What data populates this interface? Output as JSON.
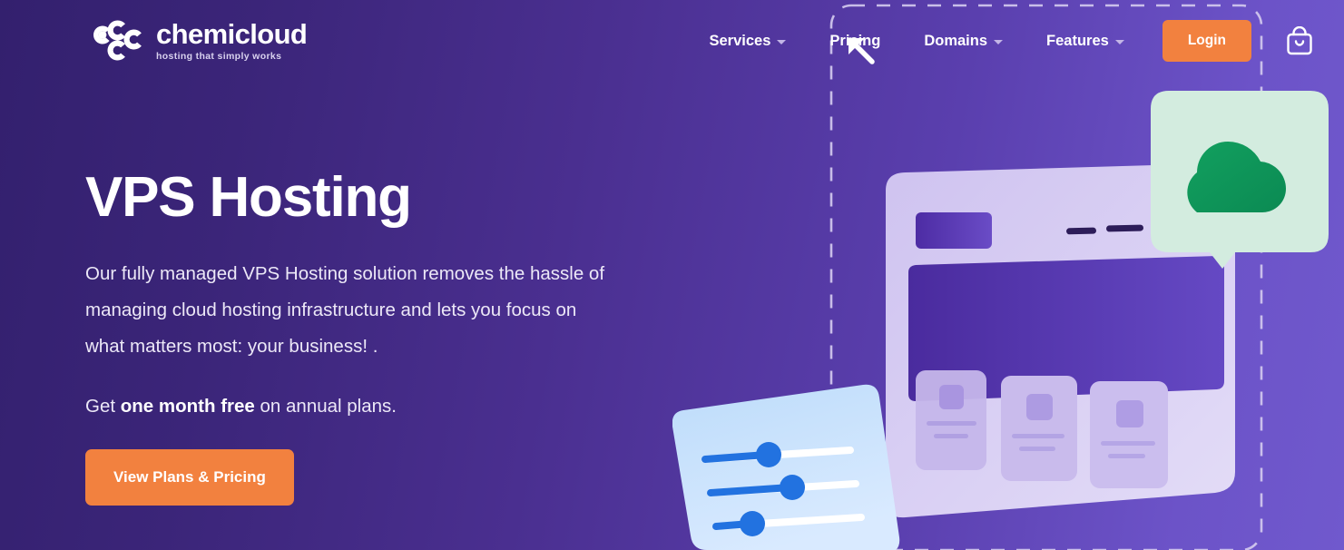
{
  "brand": {
    "name": "chemicloud",
    "tagline": "hosting that simply works",
    "logo_icon": "chemicloud-molecule-logo",
    "accent_color": "#f2813f",
    "bg_gradient_from": "#33206e",
    "bg_gradient_to": "#7059cd"
  },
  "header": {
    "nav": [
      {
        "label": "Services",
        "has_dropdown": true,
        "icon": "chevron-down-icon"
      },
      {
        "label": "Pricing",
        "has_dropdown": false,
        "icon": ""
      },
      {
        "label": "Domains",
        "has_dropdown": true,
        "icon": "chevron-down-icon"
      },
      {
        "label": "Features",
        "has_dropdown": true,
        "icon": "chevron-down-icon"
      }
    ],
    "login_label": "Login",
    "cart_icon": "shopping-bag-icon"
  },
  "hero": {
    "title": "VPS Hosting",
    "paragraph": "Our fully managed VPS Hosting solution removes the hassle of managing cloud hosting infrastructure and lets you focus on what matters most: your business! .",
    "offer_prefix": "Get ",
    "offer_highlight": "one month free",
    "offer_suffix": " on annual plans.",
    "cta_label": "View Plans & Pricing"
  },
  "illustration": {
    "name": "vps-server-dashboard-illustration",
    "elements": [
      {
        "name": "dashed-selection-frame",
        "color": "#d8d0f0"
      },
      {
        "name": "resize-arrow-top-left-icon",
        "color": "#ffffff"
      },
      {
        "name": "resize-arrow-top-right-icon",
        "color": "#ffffff"
      },
      {
        "name": "browser-window-card",
        "color": "#cfc4ee"
      },
      {
        "name": "card-header-block",
        "color": "#5b36b8"
      },
      {
        "name": "card-header-dashes",
        "color": "#2d1d59"
      },
      {
        "name": "card-main-panel",
        "color": "#5a36b4"
      },
      {
        "name": "content-card-1",
        "color": "#c6b8ea"
      },
      {
        "name": "content-card-2",
        "color": "#c6b8ea"
      },
      {
        "name": "content-card-3",
        "color": "#c6b8ea"
      },
      {
        "name": "cloud-speech-bubble",
        "color": "#d3ecdf"
      },
      {
        "name": "green-cloud-icon",
        "color": "#0e9e5c"
      },
      {
        "name": "settings-sliders-card",
        "color": "#bcdcf8"
      },
      {
        "name": "slider-handle",
        "color": "#2272e0"
      }
    ]
  }
}
